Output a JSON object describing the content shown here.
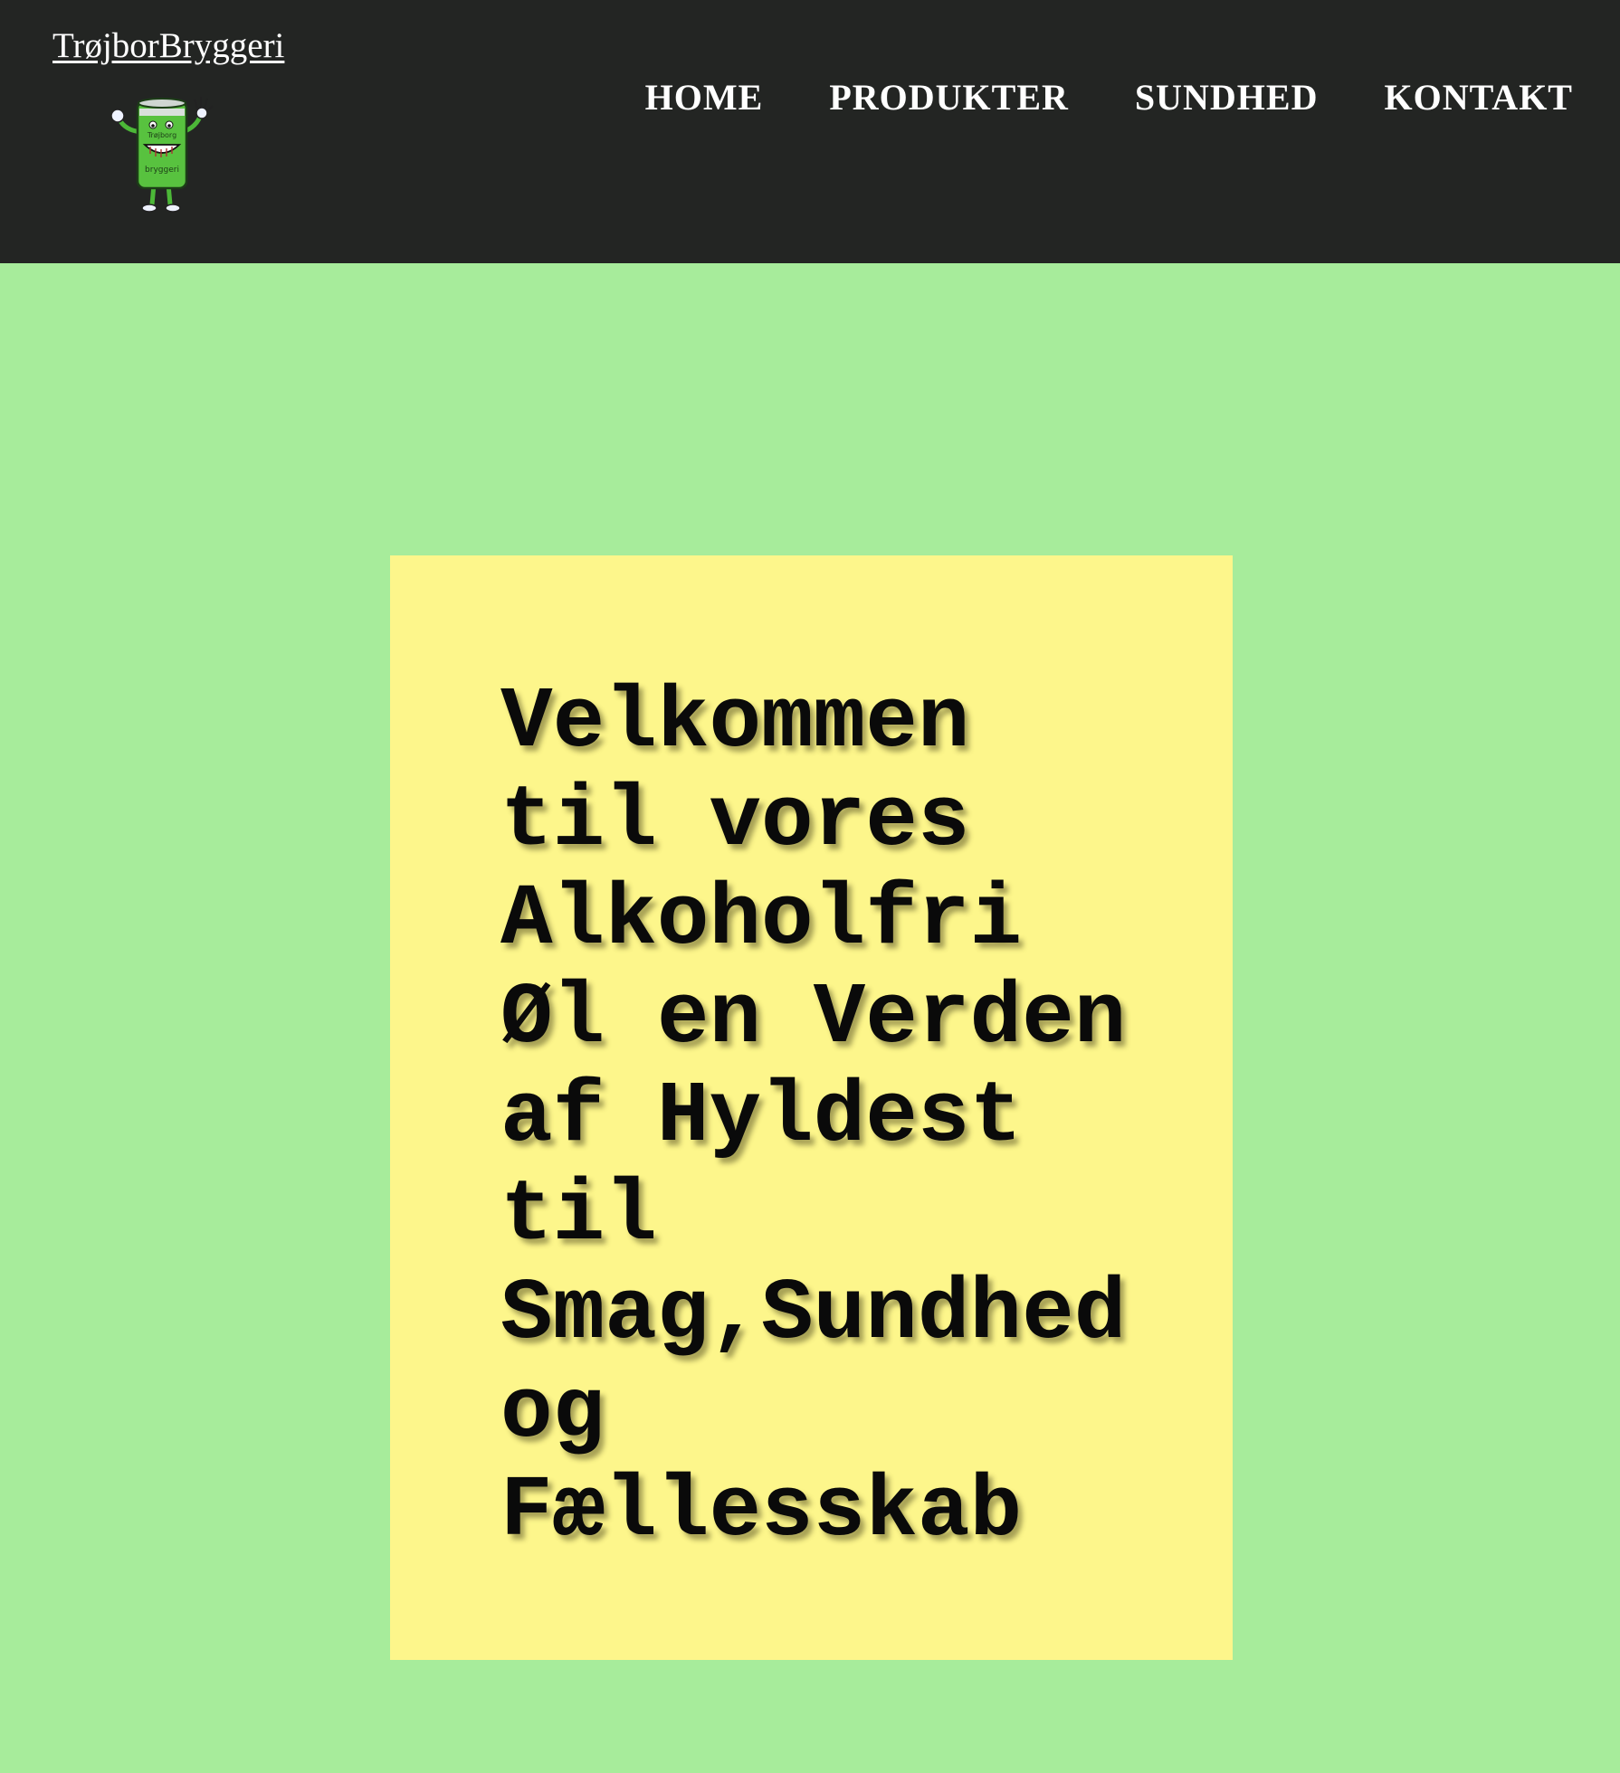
{
  "header": {
    "brand": "TrøjborBryggeri",
    "logo_icon": "beer-can-mascot-icon",
    "logo_text": [
      "Trøjborg",
      "bryggeri"
    ],
    "background": "#232523"
  },
  "nav": {
    "items": [
      {
        "label": "HOME"
      },
      {
        "label": "PRODUKTER"
      },
      {
        "label": "SUNDHED"
      },
      {
        "label": "KONTAKT"
      }
    ]
  },
  "main": {
    "background": "#a7ec9b",
    "card_background": "#fdf68b",
    "welcome_text": "Velkommen til vores Alkoholfri Øl en Verden af Hyldest til Smag,Sundhed og Fællesskab"
  }
}
